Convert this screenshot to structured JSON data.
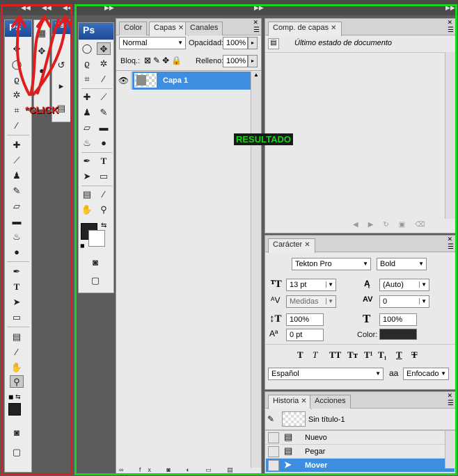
{
  "colors": {
    "highlight_result": "#1ad41a",
    "highlight_tools": "#e01c1c",
    "selection_blue": "#3d8ee0",
    "ps_badge": "#1d4a93",
    "annotation_red": "#e01c1c"
  },
  "annotations": {
    "click_label": "*CLICK",
    "result_label": "RESULTADO"
  },
  "toolbox": {
    "ps_label": "Ps",
    "collapsed_ps_label": "Ps"
  },
  "layers_panel": {
    "tabs": [
      {
        "label": "Color"
      },
      {
        "label": "Capas",
        "active": true
      },
      {
        "label": "Canales"
      }
    ],
    "blend_mode": "Normal",
    "opacity_label": "Opacidad:",
    "opacity_value": "100%",
    "lock_label": "Bloq.:",
    "fill_label": "Relleno:",
    "fill_value": "100%",
    "layers": [
      {
        "name": "Capa 1",
        "visible": true,
        "selected": true
      }
    ]
  },
  "comps_panel": {
    "tab": "Comp. de capas",
    "state_text": "Último estado de documento"
  },
  "character_panel": {
    "tab": "Carácter",
    "font_family": "Tekton Pro",
    "font_style": "Bold",
    "size": "13 pt",
    "leading": "(Auto)",
    "kerning": "Medidas",
    "tracking": "0",
    "vscale": "100%",
    "hscale": "100%",
    "baseline": "0 pt",
    "color_label": "Color:",
    "text_color": "#2a2a2a",
    "format_buttons": [
      "T",
      "T",
      "TT",
      "Tт",
      "T¹",
      "T₁",
      "T",
      "T"
    ],
    "language": "Español",
    "aa_icon": "aa",
    "antialias": "Enfocado"
  },
  "history_panel": {
    "tabs": [
      {
        "label": "Historia",
        "active": true
      },
      {
        "label": "Acciones"
      }
    ],
    "snapshot": "Sin título-1",
    "items": [
      {
        "label": "Nuevo",
        "selected": false
      },
      {
        "label": "Pegar",
        "selected": false
      },
      {
        "label": "Mover",
        "selected": true
      }
    ]
  }
}
